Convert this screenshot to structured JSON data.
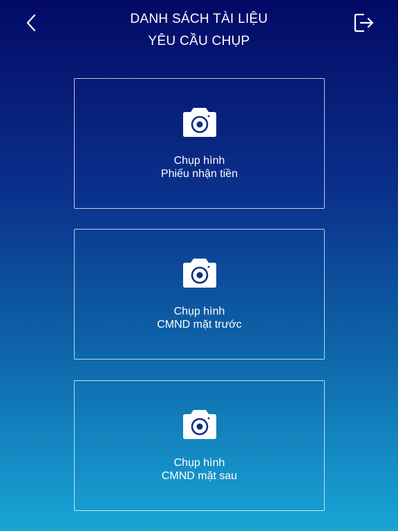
{
  "header": {
    "title_line1": "DANH SÁCH TÀI LIỆU",
    "title_line2": "YÊU CẦU CHỤP",
    "back_icon": "chevron-left-icon",
    "logout_icon": "logout-icon"
  },
  "cards": [
    {
      "line1": "Chụp hình",
      "line2": "Phiếu nhận tiền",
      "icon": "camera-icon"
    },
    {
      "line1": "Chụp hình",
      "line2": "CMND mặt trước",
      "icon": "camera-icon"
    },
    {
      "line1": "Chụp hình",
      "line2": "CMND mặt sau",
      "icon": "camera-icon"
    }
  ],
  "colors": {
    "gradient_top": "#020a66",
    "gradient_bottom": "#18a5d6",
    "icon_accent": "#0d2f86"
  }
}
